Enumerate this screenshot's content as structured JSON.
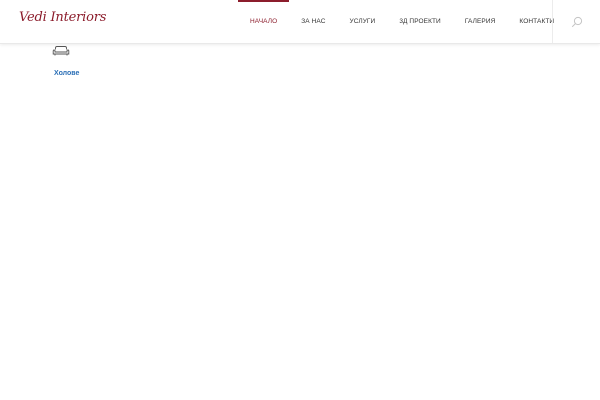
{
  "brand": {
    "logo_text": "Vedi Interiors",
    "accent_color": "#8c1d2c"
  },
  "nav": {
    "items": [
      {
        "label": "НАЧАЛО",
        "active": true
      },
      {
        "label": "ЗА НАС",
        "active": false
      },
      {
        "label": "УСЛУГИ",
        "active": false
      },
      {
        "label": "3Д ПРОЕКТИ",
        "active": false
      },
      {
        "label": "ГАЛЕРИЯ",
        "active": false
      },
      {
        "label": "КОНТАКТИ",
        "active": false
      }
    ]
  },
  "search": {
    "icon": "search-icon"
  },
  "content": {
    "category_icon": "sofa-icon",
    "category_label": "Холове",
    "link_color": "#2b6fb6"
  }
}
